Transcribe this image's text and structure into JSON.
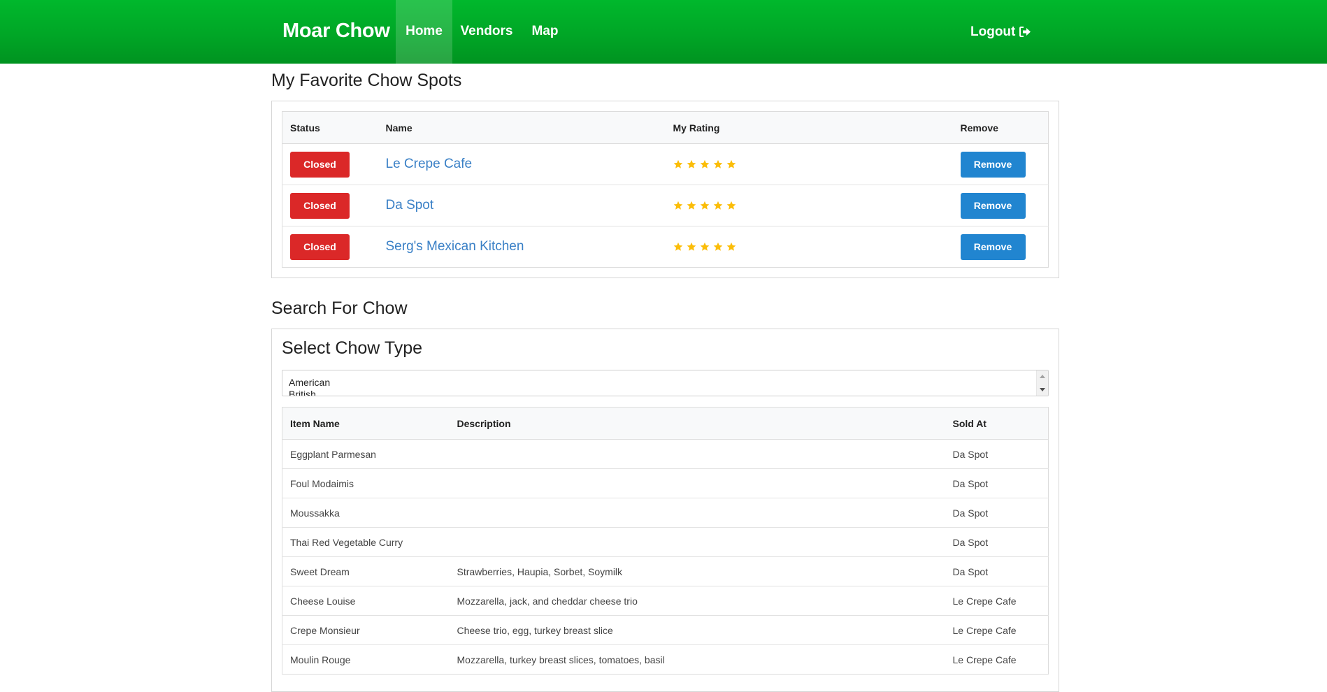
{
  "navbar": {
    "brand": "Moar Chow",
    "links": [
      {
        "label": "Home",
        "active": true
      },
      {
        "label": "Vendors"
      },
      {
        "label": "Map"
      }
    ],
    "logout_label": "Logout",
    "logout_icon": "sign-out-icon",
    "accent_color": "#00a626"
  },
  "favorites": {
    "title": "My Favorite Chow Spots",
    "headers": [
      "Status",
      "Name",
      "My Rating",
      "Remove"
    ],
    "rows": [
      {
        "status": "Closed",
        "name": "Le Crepe Cafe",
        "rating": 5,
        "remove": "Remove"
      },
      {
        "status": "Closed",
        "name": "Da Spot",
        "rating": 5,
        "remove": "Remove"
      },
      {
        "status": "Closed",
        "name": "Serg's Mexican Kitchen",
        "rating": 5,
        "remove": "Remove"
      }
    ],
    "colors": {
      "closed": "#db2828",
      "remove": "#2185d0",
      "star": "#fbbd08",
      "link": "#3a80c6"
    }
  },
  "search": {
    "title": "Search For Chow",
    "subtitle": "Select Chow Type",
    "chow_types": [
      "American",
      "British"
    ],
    "headers": [
      "Item Name",
      "Description",
      "Sold At"
    ],
    "items": [
      {
        "name": "Eggplant Parmesan",
        "description": "",
        "sold_at": "Da Spot"
      },
      {
        "name": "Foul Modaimis",
        "description": "",
        "sold_at": "Da Spot"
      },
      {
        "name": "Moussakka",
        "description": "",
        "sold_at": "Da Spot"
      },
      {
        "name": "Thai Red Vegetable Curry",
        "description": "",
        "sold_at": "Da Spot"
      },
      {
        "name": "Sweet Dream",
        "description": "Strawberries, Haupia, Sorbet, Soymilk",
        "sold_at": "Da Spot"
      },
      {
        "name": "Cheese Louise",
        "description": "Mozzarella, jack, and cheddar cheese trio",
        "sold_at": "Le Crepe Cafe"
      },
      {
        "name": "Crepe Monsieur",
        "description": "Cheese trio, egg, turkey breast slice",
        "sold_at": "Le Crepe Cafe"
      },
      {
        "name": "Moulin Rouge",
        "description": "Mozzarella, turkey breast slices, tomatoes, basil",
        "sold_at": "Le Crepe Cafe"
      }
    ]
  }
}
